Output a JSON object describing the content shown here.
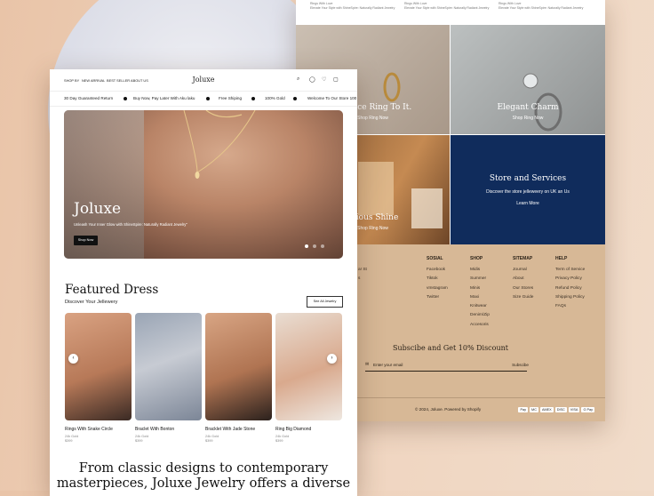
{
  "nav": {
    "links": [
      "SHOP BY",
      "NEW ARRIVAL",
      "BEST SELLER",
      "ABOUT US"
    ],
    "logo": "Joluxe"
  },
  "marquee": [
    "30 Day Guaranteed Return",
    "Buy Now, Pay Later With Aku laku",
    "Free Shiping",
    "100% Gold",
    "Welcome To Our Store 100"
  ],
  "hero": {
    "title": "Joluxe",
    "subtitle": "Unleash Your Inner Glow with ShineSpire: Naturally Radiant Jewelry\"",
    "button": "Shop Now"
  },
  "featured": {
    "title": "Featured Dress",
    "subtitle": "Discover Your Jellewery",
    "see_all": "See All Jewelry",
    "products": [
      {
        "name": "Rings With Snake Circle",
        "meta1": "24k Gold",
        "meta2": "$399"
      },
      {
        "name": "Braclet With Bonton",
        "meta1": "24k Gold",
        "meta2": "$399"
      },
      {
        "name": "Bracklet With Jade Stone",
        "meta1": "24k Gold",
        "meta2": "$399"
      },
      {
        "name": "Ring Big Diamond",
        "meta1": "24k Gold",
        "meta2": "$399"
      }
    ]
  },
  "bottom_text": [
    "From classic designs to contemporary",
    "masterpieces, Joluxe Jewelry offers a diverse"
  ],
  "back": {
    "top_snippets": [
      {
        "l1": "Rings With Love",
        "l2": "Elevate Your Style with ShineSpire: Naturally Radiant Jewelry"
      },
      {
        "l1": "Rings With Love",
        "l2": "Elevate Your Style with ShineSpire: Naturally Radiant Jewelry"
      },
      {
        "l1": "Rings With Love",
        "l2": "Elevate Your Style with ShineSpire: Naturally Radiant Jewelry"
      }
    ],
    "tiles": [
      {
        "title": "s a Nice Ring To It.",
        "cta": "Shop Ring Now"
      },
      {
        "title": "Elegant Charm",
        "cta": "Shop Ring Now"
      },
      {
        "title": "urious Shine",
        "cta": "Shop Ring Now"
      },
      {
        "title": "Store and Services",
        "sub": "Discover the store jelleweery on UK an Us",
        "cta": "Learn More"
      }
    ],
    "footer": {
      "partial": [
        "a! St",
        "s"
      ],
      "cols": [
        {
          "head": "SOSIAL",
          "items": [
            "Facebook",
            "Tiktok",
            "vInstagram",
            "Twitter"
          ]
        },
        {
          "head": "SHOP",
          "items": [
            "Midis",
            "Summer",
            "Minis",
            "Maxi",
            "Knitwear",
            "Denim/Zip",
            "Accesoris"
          ]
        },
        {
          "head": "SITEMAP",
          "items": [
            "Journal",
            "About",
            "Our Stores",
            "Size Guide"
          ]
        },
        {
          "head": "HELP",
          "items": [
            "Term of Service",
            "Privacy Policy",
            "Refund Policy",
            "Shipping Policy",
            "FAQs"
          ]
        }
      ],
      "subscribe_title": "Subscibe and Get 10% Discount",
      "email_placeholder": "Enter your email",
      "subscribe_button": "Subscibe",
      "copyright": "2024, Joluxe. Powered by Shopify",
      "payments": [
        "Pay",
        "MC",
        "AMEX",
        "DISC",
        "VISA",
        "G Pay"
      ]
    }
  }
}
